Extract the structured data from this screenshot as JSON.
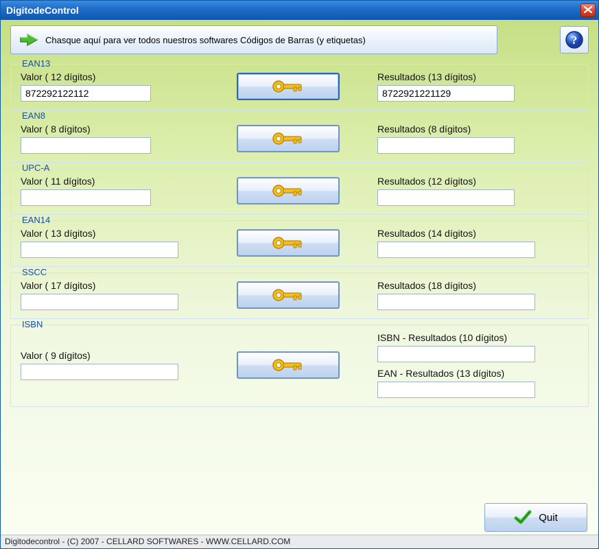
{
  "window": {
    "title": "DigitodeControl"
  },
  "top": {
    "banner_text": "Chasque aquí para ver todos nuestros softwares  Códigos de Barras (y etiquetas)"
  },
  "groups": {
    "ean13": {
      "legend": "EAN13",
      "input_label": "Valor ( 12 dígitos)",
      "input_value": "872292122112",
      "result_label": "Resultados (13 dígitos)",
      "result_value": "8722921221129"
    },
    "ean8": {
      "legend": "EAN8",
      "input_label": "Valor ( 8 dígitos)",
      "input_value": "",
      "result_label": "Resultados (8 dígitos)",
      "result_value": ""
    },
    "upca": {
      "legend": "UPC-A",
      "input_label": "Valor  ( 11 dígitos)",
      "input_value": "",
      "result_label": "Resultados (12 dígitos)",
      "result_value": ""
    },
    "ean14": {
      "legend": "EAN14",
      "input_label": "Valor ( 13 dígitos)",
      "input_value": "",
      "result_label": "Resultados (14 dígitos)",
      "result_value": ""
    },
    "sscc": {
      "legend": "SSCC",
      "input_label": "Valor ( 17 dígitos)",
      "input_value": "",
      "result_label": "Resultados (18 dígitos)",
      "result_value": ""
    },
    "isbn": {
      "legend": "ISBN",
      "input_label": "Valor ( 9 dígitos)",
      "input_value": "",
      "result1_label": "ISBN - Resultados (10 dígitos)",
      "result1_value": "",
      "result2_label": "EAN - Resultados (13 dígitos)",
      "result2_value": ""
    }
  },
  "buttons": {
    "quit": "Quit"
  },
  "status": "Digitodecontrol - (C) 2007 - CELLARD SOFTWARES - WWW.CELLARD.COM"
}
